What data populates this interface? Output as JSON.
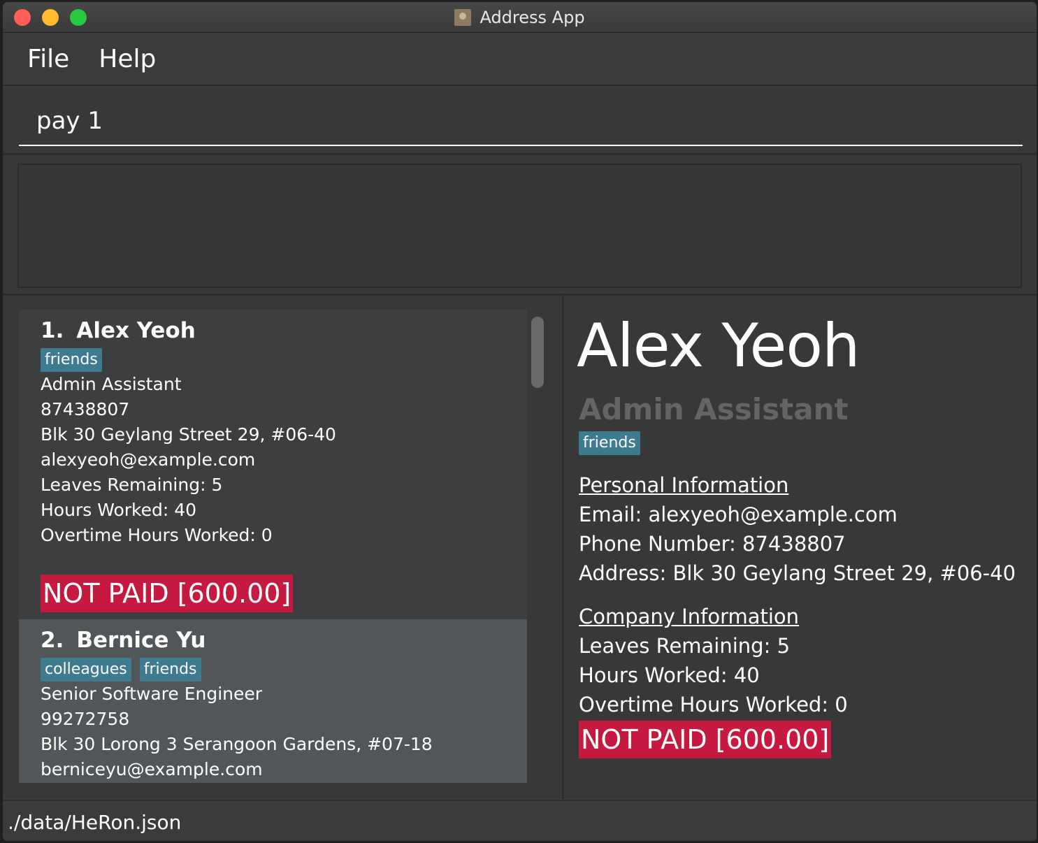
{
  "window": {
    "title": "Address App"
  },
  "menu": {
    "file": "File",
    "help": "Help"
  },
  "command": {
    "value": "pay 1"
  },
  "persons": [
    {
      "index": "1.",
      "name": "Alex Yeoh",
      "tags": [
        "friends"
      ],
      "role": "Admin Assistant",
      "phone": "87438807",
      "address": "Blk 30 Geylang Street 29, #06-40",
      "email": "alexyeoh@example.com",
      "leaves": "Leaves Remaining: 5",
      "hours": "Hours Worked: 40",
      "overtime": "Overtime Hours Worked: 0",
      "pay_status": "NOT PAID [600.00]"
    },
    {
      "index": "2.",
      "name": "Bernice Yu",
      "tags": [
        "colleagues",
        "friends"
      ],
      "role": "Senior Software Engineer",
      "phone": "99272758",
      "address": "Blk 30 Lorong 3 Serangoon Gardens, #07-18",
      "email": "berniceyu@example.com"
    }
  ],
  "detail": {
    "name": "Alex Yeoh",
    "role": "Admin Assistant",
    "tag": "friends",
    "personal_title": "Personal Information",
    "email": "Email: alexyeoh@example.com",
    "phone": "Phone Number: 87438807",
    "address": "Address: Blk 30 Geylang Street 29, #06-40",
    "company_title": "Company Information",
    "leaves": "Leaves Remaining: 5",
    "hours": "Hours Worked: 40",
    "overtime": "Overtime Hours Worked: 0",
    "pay_status": "NOT PAID [600.00]"
  },
  "status": {
    "file_path": "./data/HeRon.json"
  },
  "colors": {
    "tag": "#3e7b91",
    "not_paid": "#c6193f",
    "selected_card": "#515658"
  }
}
